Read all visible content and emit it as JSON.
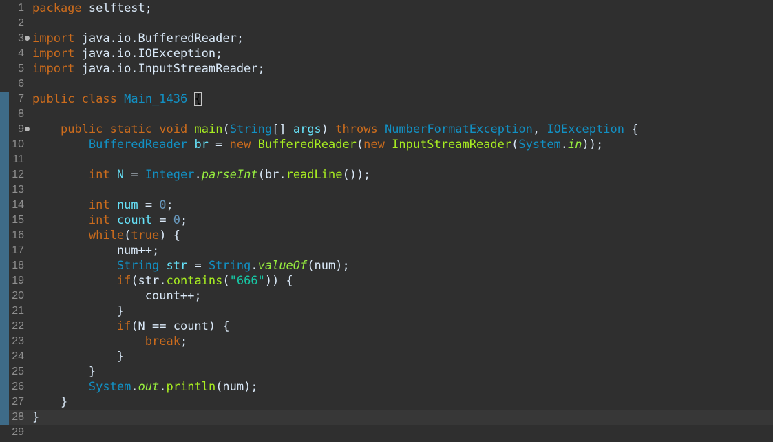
{
  "editor": {
    "current_line": 28,
    "gutter_marked_lines": [
      7,
      8,
      9,
      10,
      11,
      12,
      13,
      14,
      15,
      16,
      17,
      18,
      19,
      20,
      21,
      22,
      23,
      24,
      25,
      26,
      27,
      28
    ],
    "fold_lines": [
      3,
      9
    ],
    "colors": {
      "background": "#2f2f2f",
      "current_line": "#373737",
      "gutter_mark": "#3e6b88",
      "line_number": "#8f8f8f",
      "keyword": "#cc6c1d",
      "type": "#1290c3",
      "method": "#a7ec21",
      "string": "#17c6a3",
      "number": "#6897bb",
      "plain": "#d9e8f7"
    },
    "lines": [
      {
        "n": 1,
        "tokens": [
          {
            "t": "package",
            "c": "kw"
          },
          {
            "t": " selftest;",
            "c": "plain"
          }
        ]
      },
      {
        "n": 2,
        "tokens": []
      },
      {
        "n": 3,
        "tokens": [
          {
            "t": "import",
            "c": "kw"
          },
          {
            "t": " java.io.BufferedReader;",
            "c": "plain"
          }
        ]
      },
      {
        "n": 4,
        "tokens": [
          {
            "t": "import",
            "c": "kw"
          },
          {
            "t": " java.io.IOException;",
            "c": "plain"
          }
        ]
      },
      {
        "n": 5,
        "tokens": [
          {
            "t": "import",
            "c": "kw"
          },
          {
            "t": " java.io.InputStreamReader;",
            "c": "plain"
          }
        ]
      },
      {
        "n": 6,
        "tokens": []
      },
      {
        "n": 7,
        "tokens": [
          {
            "t": "public",
            "c": "kw"
          },
          {
            "t": " ",
            "c": "plain"
          },
          {
            "t": "class",
            "c": "kw"
          },
          {
            "t": " ",
            "c": "plain"
          },
          {
            "t": "Main_1436",
            "c": "type"
          },
          {
            "t": " ",
            "c": "plain"
          },
          {
            "t": "{",
            "c": "bracket"
          }
        ]
      },
      {
        "n": 8,
        "tokens": []
      },
      {
        "n": 9,
        "tokens": [
          {
            "t": "    ",
            "c": "plain"
          },
          {
            "t": "public",
            "c": "kw"
          },
          {
            "t": " ",
            "c": "plain"
          },
          {
            "t": "static",
            "c": "kw"
          },
          {
            "t": " ",
            "c": "plain"
          },
          {
            "t": "void",
            "c": "kw"
          },
          {
            "t": " ",
            "c": "plain"
          },
          {
            "t": "main",
            "c": "fn"
          },
          {
            "t": "(",
            "c": "plain"
          },
          {
            "t": "String",
            "c": "type"
          },
          {
            "t": "[] ",
            "c": "plain"
          },
          {
            "t": "args",
            "c": "field"
          },
          {
            "t": ") ",
            "c": "plain"
          },
          {
            "t": "throws",
            "c": "kw"
          },
          {
            "t": " ",
            "c": "plain"
          },
          {
            "t": "NumberFormatException",
            "c": "type"
          },
          {
            "t": ", ",
            "c": "plain"
          },
          {
            "t": "IOException",
            "c": "type"
          },
          {
            "t": " {",
            "c": "plain"
          }
        ]
      },
      {
        "n": 10,
        "tokens": [
          {
            "t": "        ",
            "c": "plain"
          },
          {
            "t": "BufferedReader",
            "c": "type"
          },
          {
            "t": " ",
            "c": "plain"
          },
          {
            "t": "br",
            "c": "field"
          },
          {
            "t": " = ",
            "c": "plain"
          },
          {
            "t": "new",
            "c": "kw"
          },
          {
            "t": " ",
            "c": "plain"
          },
          {
            "t": "BufferedReader",
            "c": "fn"
          },
          {
            "t": "(",
            "c": "plain"
          },
          {
            "t": "new",
            "c": "kw"
          },
          {
            "t": " ",
            "c": "plain"
          },
          {
            "t": "InputStreamReader",
            "c": "fn"
          },
          {
            "t": "(",
            "c": "plain"
          },
          {
            "t": "System",
            "c": "type"
          },
          {
            "t": ".",
            "c": "plain"
          },
          {
            "t": "in",
            "c": "static"
          },
          {
            "t": "));",
            "c": "plain"
          }
        ]
      },
      {
        "n": 11,
        "tokens": []
      },
      {
        "n": 12,
        "tokens": [
          {
            "t": "        ",
            "c": "plain"
          },
          {
            "t": "int",
            "c": "kw"
          },
          {
            "t": " ",
            "c": "plain"
          },
          {
            "t": "N",
            "c": "field"
          },
          {
            "t": " = ",
            "c": "plain"
          },
          {
            "t": "Integer",
            "c": "type"
          },
          {
            "t": ".",
            "c": "plain"
          },
          {
            "t": "parseInt",
            "c": "static"
          },
          {
            "t": "(br.",
            "c": "plain"
          },
          {
            "t": "readLine",
            "c": "fn"
          },
          {
            "t": "());",
            "c": "plain"
          }
        ]
      },
      {
        "n": 13,
        "tokens": []
      },
      {
        "n": 14,
        "tokens": [
          {
            "t": "        ",
            "c": "plain"
          },
          {
            "t": "int",
            "c": "kw"
          },
          {
            "t": " ",
            "c": "plain"
          },
          {
            "t": "num",
            "c": "field"
          },
          {
            "t": " = ",
            "c": "plain"
          },
          {
            "t": "0",
            "c": "num"
          },
          {
            "t": ";",
            "c": "plain"
          }
        ]
      },
      {
        "n": 15,
        "tokens": [
          {
            "t": "        ",
            "c": "plain"
          },
          {
            "t": "int",
            "c": "kw"
          },
          {
            "t": " ",
            "c": "plain"
          },
          {
            "t": "count",
            "c": "field"
          },
          {
            "t": " = ",
            "c": "plain"
          },
          {
            "t": "0",
            "c": "num"
          },
          {
            "t": ";",
            "c": "plain"
          }
        ]
      },
      {
        "n": 16,
        "tokens": [
          {
            "t": "        ",
            "c": "plain"
          },
          {
            "t": "while",
            "c": "kw"
          },
          {
            "t": "(",
            "c": "plain"
          },
          {
            "t": "true",
            "c": "kw"
          },
          {
            "t": ") {",
            "c": "plain"
          }
        ]
      },
      {
        "n": 17,
        "tokens": [
          {
            "t": "            num++;",
            "c": "plain"
          }
        ]
      },
      {
        "n": 18,
        "tokens": [
          {
            "t": "            ",
            "c": "plain"
          },
          {
            "t": "String",
            "c": "type"
          },
          {
            "t": " ",
            "c": "plain"
          },
          {
            "t": "str",
            "c": "field"
          },
          {
            "t": " = ",
            "c": "plain"
          },
          {
            "t": "String",
            "c": "type"
          },
          {
            "t": ".",
            "c": "plain"
          },
          {
            "t": "valueOf",
            "c": "static"
          },
          {
            "t": "(num);",
            "c": "plain"
          }
        ]
      },
      {
        "n": 19,
        "tokens": [
          {
            "t": "            ",
            "c": "plain"
          },
          {
            "t": "if",
            "c": "kw"
          },
          {
            "t": "(str.",
            "c": "plain"
          },
          {
            "t": "contains",
            "c": "fn"
          },
          {
            "t": "(",
            "c": "plain"
          },
          {
            "t": "\"666\"",
            "c": "str"
          },
          {
            "t": ")) {",
            "c": "plain"
          }
        ]
      },
      {
        "n": 20,
        "tokens": [
          {
            "t": "                count++;",
            "c": "plain"
          }
        ]
      },
      {
        "n": 21,
        "tokens": [
          {
            "t": "            }",
            "c": "plain"
          }
        ]
      },
      {
        "n": 22,
        "tokens": [
          {
            "t": "            ",
            "c": "plain"
          },
          {
            "t": "if",
            "c": "kw"
          },
          {
            "t": "(N == count) {",
            "c": "plain"
          }
        ]
      },
      {
        "n": 23,
        "tokens": [
          {
            "t": "                ",
            "c": "plain"
          },
          {
            "t": "break",
            "c": "kw"
          },
          {
            "t": ";",
            "c": "plain"
          }
        ]
      },
      {
        "n": 24,
        "tokens": [
          {
            "t": "            }",
            "c": "plain"
          }
        ]
      },
      {
        "n": 25,
        "tokens": [
          {
            "t": "        }",
            "c": "plain"
          }
        ]
      },
      {
        "n": 26,
        "tokens": [
          {
            "t": "        ",
            "c": "plain"
          },
          {
            "t": "System",
            "c": "type"
          },
          {
            "t": ".",
            "c": "plain"
          },
          {
            "t": "out",
            "c": "static"
          },
          {
            "t": ".",
            "c": "plain"
          },
          {
            "t": "println",
            "c": "fn"
          },
          {
            "t": "(num);",
            "c": "plain"
          }
        ]
      },
      {
        "n": 27,
        "tokens": [
          {
            "t": "    }",
            "c": "plain"
          }
        ]
      },
      {
        "n": 28,
        "tokens": [
          {
            "t": "}",
            "c": "plain"
          }
        ]
      },
      {
        "n": 29,
        "tokens": []
      }
    ]
  }
}
